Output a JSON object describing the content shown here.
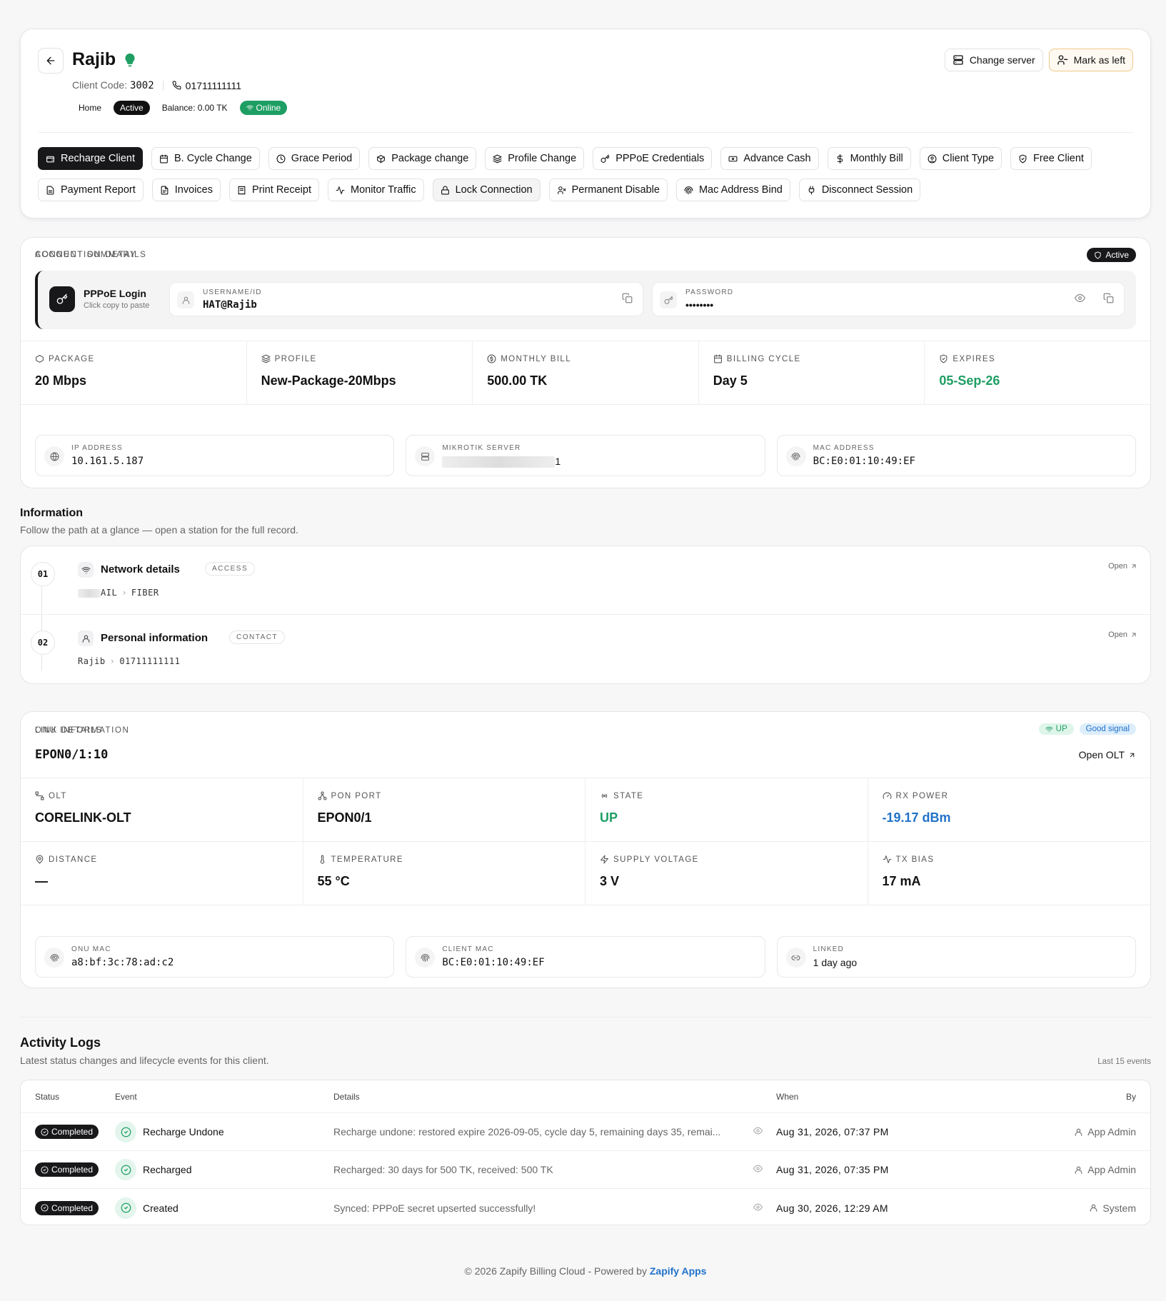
{
  "client": {
    "name": "Rajib",
    "code_label": "Client Code:",
    "code": "3002",
    "phone": "01711111111",
    "tags": [
      "Home",
      "Active",
      "Balance: 0.00 TK",
      "Online"
    ]
  },
  "top_actions": {
    "change_server": "Change server",
    "mark_left": "Mark as left"
  },
  "actions_row1": [
    "Recharge Client",
    "B. Cycle Change",
    "Grace Period",
    "Package change",
    "Profile Change",
    "PPPoE Credentials",
    "Advance Cash",
    "Monthly Bill",
    "Client Type",
    "Free Client"
  ],
  "actions_row2": [
    "Payment Report",
    "Invoices",
    "Print Receipt",
    "Monitor Traffic",
    "Lock Connection",
    "Permanent Disable",
    "Mac Address Bind",
    "Disconnect Session"
  ],
  "account": {
    "label": "ACCOUNT SUMMARY",
    "status": "Active",
    "login_title": "PPPoE Login",
    "login_sub": "Click copy to paste",
    "username_label": "USERNAME/ID",
    "username": "HAT@Rajib",
    "password_label": "PASSWORD",
    "password": "••••••••",
    "stats": [
      {
        "label": "PACKAGE",
        "value": "20 Mbps"
      },
      {
        "label": "PROFILE",
        "value": "New-Package-20Mbps"
      },
      {
        "label": "MONTHLY BILL",
        "value": "500.00 TK"
      },
      {
        "label": "BILLING CYCLE",
        "value": "Day 5"
      },
      {
        "label": "EXPIRES",
        "value": "05-Sep-26"
      }
    ],
    "conn_label": "CONNECTION DETAILS",
    "ip_label": "IP ADDRESS",
    "ip": "10.161.5.187",
    "server_label": "MIKROTIK SERVER",
    "server_suffix": "1",
    "mac_label": "MAC ADDRESS",
    "mac": "BC:E0:01:10:49:EF"
  },
  "information": {
    "title": "Information",
    "subtitle": "Follow the path at a glance — open a station for the full record.",
    "open": "Open",
    "rows": [
      {
        "num": "01",
        "title": "Network details",
        "pill": "ACCESS",
        "path1": "AIL",
        "path2": "FIBER"
      },
      {
        "num": "02",
        "title": "Personal information",
        "pill": "CONTACT",
        "path1": "Rajib",
        "path2": "01711111111"
      }
    ]
  },
  "onu": {
    "label": "ONU INFORMATION",
    "name": "EPON0/1:10",
    "badge_up": "UP",
    "badge_signal": "Good signal",
    "open_olt": "Open OLT",
    "cells": [
      {
        "label": "OLT",
        "value": "CORELINK-OLT"
      },
      {
        "label": "PON PORT",
        "value": "EPON0/1"
      },
      {
        "label": "STATE",
        "value": "UP"
      },
      {
        "label": "RX POWER",
        "value": "-19.17 dBm"
      },
      {
        "label": "DISTANCE",
        "value": "—"
      },
      {
        "label": "TEMPERATURE",
        "value": "55 °C"
      },
      {
        "label": "SUPPLY VOLTAGE",
        "value": "3 V"
      },
      {
        "label": "TX BIAS",
        "value": "17 mA"
      }
    ],
    "link_label": "LINK DETAILS",
    "onu_mac_label": "ONU MAC",
    "onu_mac": "a8:bf:3c:78:ad:c2",
    "client_mac_label": "CLIENT MAC",
    "client_mac": "BC:E0:01:10:49:EF",
    "linked_label": "LINKED",
    "linked": "1 day ago"
  },
  "activity": {
    "title": "Activity Logs",
    "subtitle": "Latest status changes and lifecycle events for this client.",
    "count": "Last 15 events",
    "headers": {
      "status": "Status",
      "event": "Event",
      "details": "Details",
      "when": "When",
      "by": "By"
    },
    "rows": [
      {
        "status": "Completed",
        "event": "Recharge Undone",
        "details": "Recharge undone: restored expire 2026-09-05, cycle day 5, remaining days 35, remai...",
        "when": "Aug 31, 2026, 07:37 PM",
        "by": "App Admin"
      },
      {
        "status": "Completed",
        "event": "Recharged",
        "details": "Recharged: 30 days for 500 TK, received: 500 TK",
        "when": "Aug 31, 2026, 07:35 PM",
        "by": "App Admin"
      },
      {
        "status": "Completed",
        "event": "Created",
        "details": "Synced: PPPoE secret upserted successfully!",
        "when": "Aug 30, 2026, 12:29 AM",
        "by": "System"
      }
    ]
  },
  "footer": {
    "text": "© 2026 Zapify Billing Cloud - Powered by",
    "link": "Zapify Apps"
  },
  "colors": {
    "accent_green": "#1e9e63",
    "accent_blue": "#2172c9",
    "dark": "#18181b"
  }
}
